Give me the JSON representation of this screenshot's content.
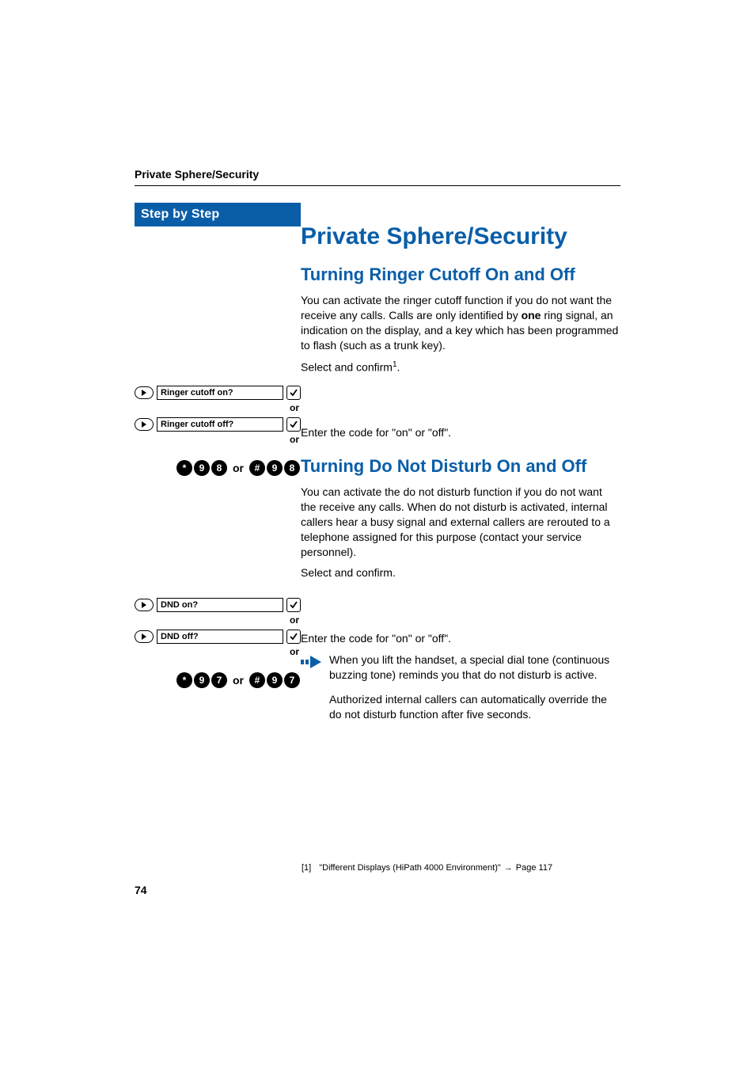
{
  "header": {
    "running": "Private Sphere/Security"
  },
  "sidebar": {
    "step_header": "Step by Step",
    "ringer_on_display": "Ringer cutoff on?",
    "ringer_off_display": "Ringer cutoff off?",
    "dnd_on_display": "DND on?",
    "dnd_off_display": "DND off?",
    "or_label": "or",
    "keys_ringer": {
      "set1": [
        "*",
        "9",
        "8"
      ],
      "set2": [
        "#",
        "9",
        "8"
      ]
    },
    "keys_dnd": {
      "set1": [
        "*",
        "9",
        "7"
      ],
      "set2": [
        "#",
        "9",
        "7"
      ]
    }
  },
  "main": {
    "h1": "Private Sphere/Security",
    "h2_ringer": "Turning Ringer Cutoff On and Off",
    "p_ringer_intro_pre": "You can activate the ringer cutoff function if you do not want the receive any calls. Calls are only identified by ",
    "p_ringer_intro_bold": "one",
    "p_ringer_intro_post": " ring signal, an indication on the display, and a key which has been programmed to flash (such as a trunk key).",
    "select_confirm_fn": "Select and confirm",
    "footnote_marker": "1",
    "period": ".",
    "enter_code": "Enter the code for \"on\" or \"off\".",
    "h2_dnd": "Turning Do Not Disturb On and Off",
    "p_dnd_intro": "You can activate the do not disturb function if you do not want the receive any calls. When do not disturb is activated, internal callers hear a busy signal and external callers are rerouted to a telephone assigned for this purpose (contact your service personnel).",
    "select_confirm": "Select and confirm.",
    "note1": "When you lift the handset, a special dial tone (continuous buzzing tone) reminds you that do not disturb is active.",
    "note2": "Authorized internal callers can automatically override the do not disturb function after five seconds."
  },
  "footnote": {
    "marker": "[1]",
    "text": "\"Different Displays (HiPath 4000 Environment)\"",
    "arrow": "→",
    "page_ref": "Page 117"
  },
  "page_number": "74"
}
